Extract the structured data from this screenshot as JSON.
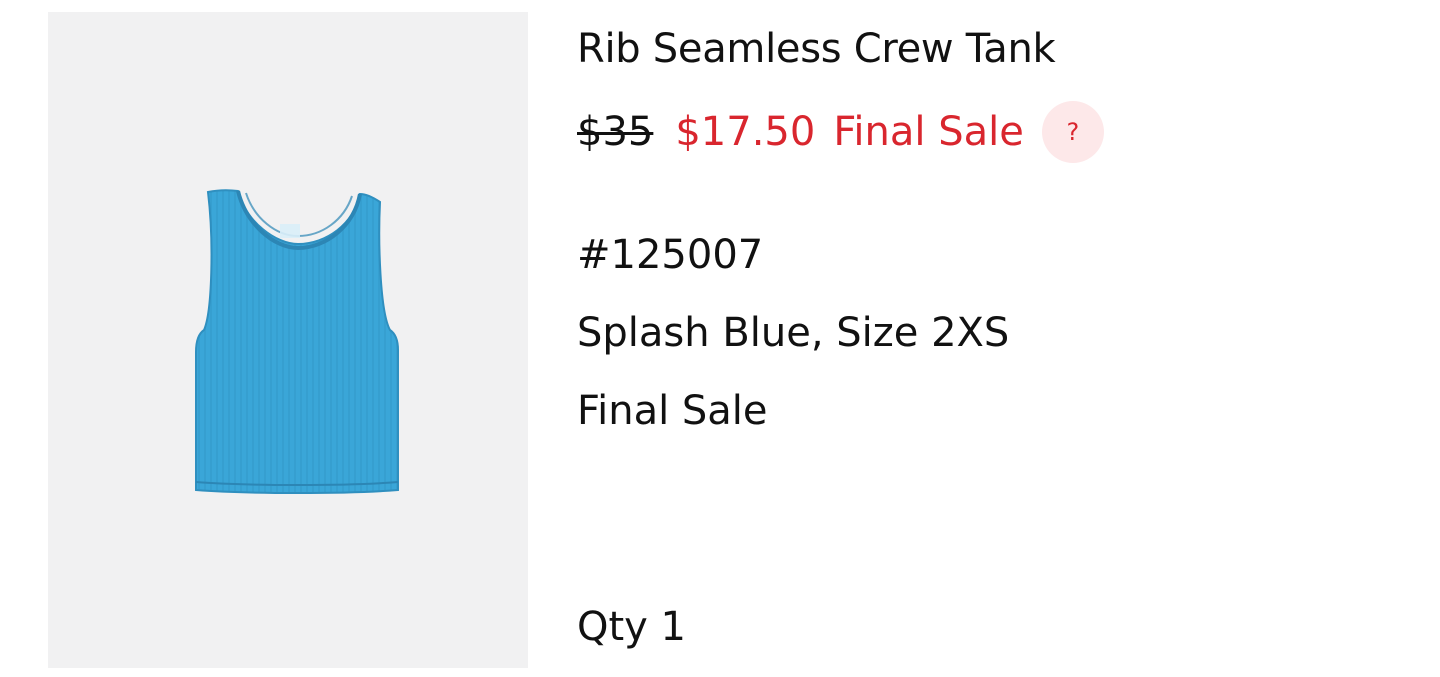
{
  "product": {
    "title": "Rib Seamless Crew Tank",
    "image_alt": "Splash Blue ribbed crew tank top",
    "price_original": "$35",
    "price_sale": "$17.50",
    "sale_label": "Final Sale",
    "help_label": "?",
    "sku": "#125007",
    "variant": "Splash Blue, Size 2XS",
    "final_sale_note": "Final Sale",
    "qty": "Qty 1"
  },
  "colors": {
    "sale_red": "#d9262e",
    "help_bg": "#fde8e9",
    "image_bg": "#f1f1f2",
    "garment_blue": "#3aa6d8"
  }
}
